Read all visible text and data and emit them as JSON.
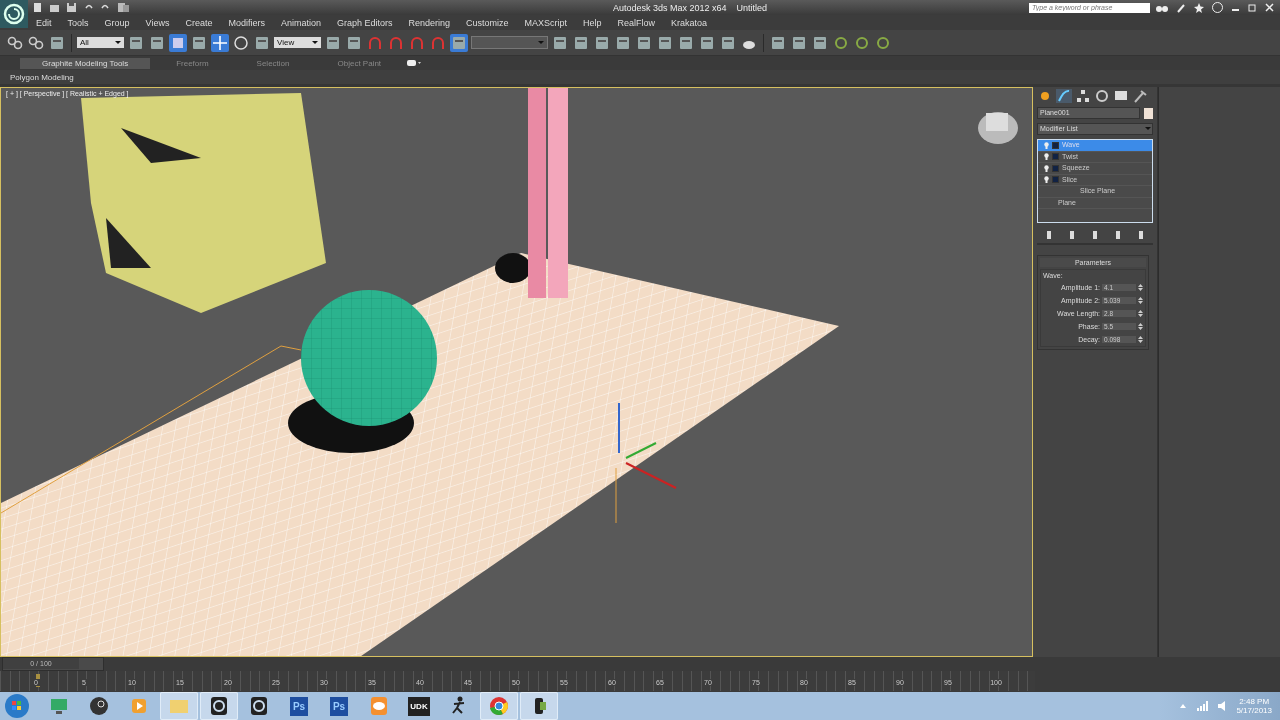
{
  "app": {
    "title": "Autodesk 3ds Max  2012 x64",
    "document": "Untitled",
    "search": {
      "placeholder": "Type a keyword or phrase"
    }
  },
  "menu": [
    "Edit",
    "Tools",
    "Group",
    "Views",
    "Create",
    "Modifiers",
    "Animation",
    "Graph Editors",
    "Rendering",
    "Customize",
    "MAXScript",
    "Help",
    "RealFlow",
    "Krakatoa"
  ],
  "toolbar": {
    "selection_filter": "All",
    "reference_coord": "View"
  },
  "ribbon": {
    "tabs": [
      {
        "label": "Graphite Modeling Tools",
        "selected": true
      },
      {
        "label": "Freeform",
        "selected": false
      },
      {
        "label": "Selection",
        "selected": false
      },
      {
        "label": "Object Paint",
        "selected": false
      }
    ],
    "panel": "Polygon Modeling"
  },
  "viewport": {
    "label": "[ + ] [ Perspective ] [ Realistic + Edged ]"
  },
  "command_panel": {
    "tabs": [
      {
        "kind": "create",
        "selected": false
      },
      {
        "kind": "modify",
        "selected": true
      },
      {
        "kind": "hierarchy",
        "selected": false
      },
      {
        "kind": "motion",
        "selected": false
      },
      {
        "kind": "display",
        "selected": false
      },
      {
        "kind": "utilities",
        "selected": false
      }
    ],
    "object_name": "Plane001",
    "modifier_list": "Modifier List",
    "stack": [
      {
        "label": "Wave",
        "kind": "modifier",
        "selected": true
      },
      {
        "label": "Twist",
        "kind": "modifier",
        "selected": false
      },
      {
        "label": "Squeeze",
        "kind": "modifier",
        "selected": false
      },
      {
        "label": "Slice",
        "kind": "modifier",
        "selected": false,
        "children": [
          {
            "label": "Slice Plane",
            "selected": false
          }
        ]
      },
      {
        "label": "Plane",
        "kind": "base",
        "selected": false
      }
    ],
    "parameters": {
      "title": "Parameters",
      "group": "Wave:",
      "fields": [
        {
          "label": "Amplitude 1:",
          "value": "4.1"
        },
        {
          "label": "Amplitude 2:",
          "value": "5.039"
        },
        {
          "label": "Wave Length:",
          "value": "2.8"
        },
        {
          "label": "Phase:",
          "value": "5.5"
        },
        {
          "label": "Decay:",
          "value": "0.098"
        }
      ]
    }
  },
  "timeline": {
    "frame": "0 / 100",
    "level": 0,
    "ticks": [
      "0",
      "5",
      "10",
      "15",
      "20",
      "25",
      "30",
      "35",
      "40",
      "45",
      "50",
      "55",
      "60",
      "65",
      "70",
      "75",
      "80",
      "85",
      "90",
      "95",
      "100"
    ]
  },
  "taskbar": {
    "apps": [
      {
        "kind": "monitor",
        "active": false
      },
      {
        "kind": "steam",
        "active": false
      },
      {
        "kind": "media",
        "active": false
      },
      {
        "kind": "folder",
        "active": true
      },
      {
        "kind": "max",
        "active": true
      },
      {
        "kind": "max",
        "active": false
      },
      {
        "kind": "ps",
        "label": "Ps",
        "active": false
      },
      {
        "kind": "ps",
        "label": "Ps",
        "active": false
      },
      {
        "kind": "orange",
        "active": false
      },
      {
        "kind": "udk",
        "label": "UDK",
        "active": false
      },
      {
        "kind": "figure",
        "active": false
      },
      {
        "kind": "chrome",
        "active": true
      },
      {
        "kind": "camera",
        "active": true
      }
    ],
    "clock": {
      "time": "2:48 PM",
      "date": "5/17/2013"
    }
  }
}
